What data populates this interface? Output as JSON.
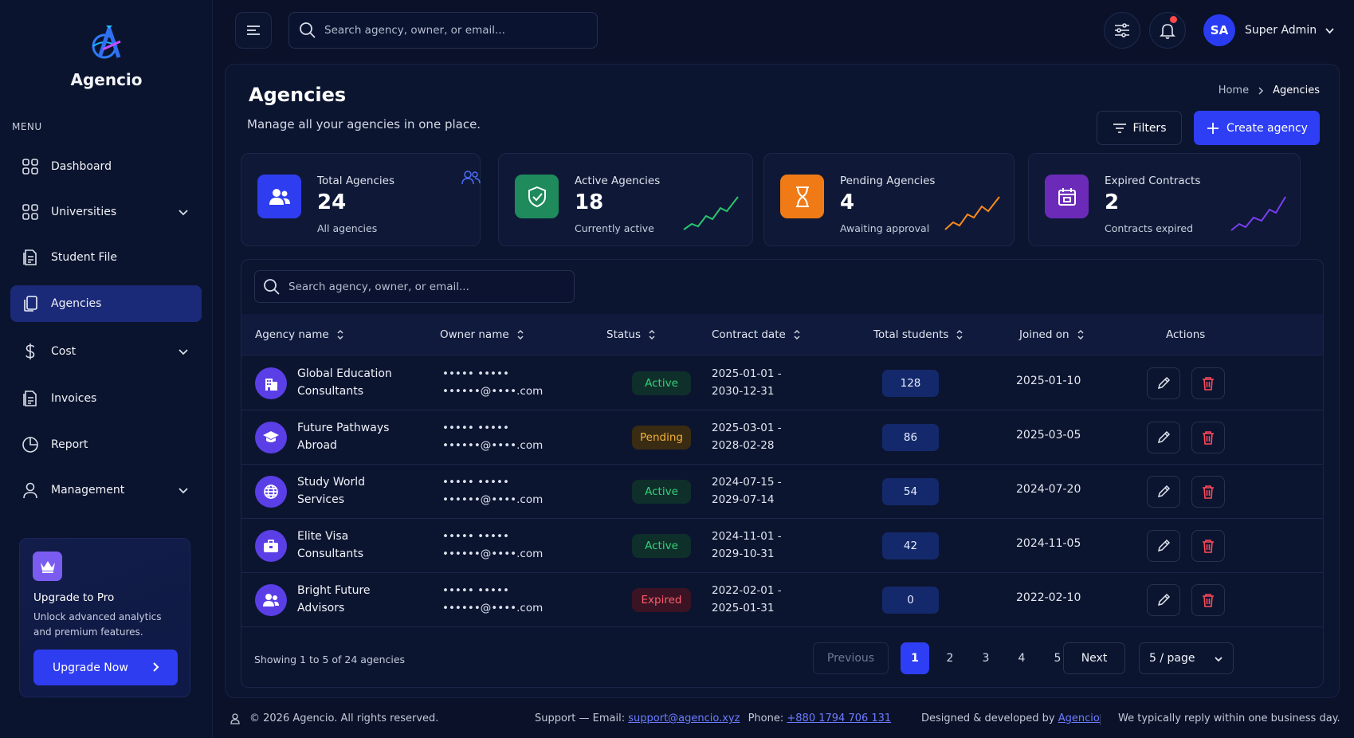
{
  "brand": {
    "name": "Agencio"
  },
  "sidebar": {
    "menu_label": "MENU",
    "items": [
      {
        "label": "Dashboard",
        "icon": "grid-icon",
        "has_chevron": false,
        "active": false
      },
      {
        "label": "Universities",
        "icon": "grid-icon",
        "has_chevron": true,
        "active": false
      },
      {
        "label": "Student File",
        "icon": "file-icon",
        "has_chevron": false,
        "active": false
      },
      {
        "label": "Agencies",
        "icon": "copy-icon",
        "has_chevron": false,
        "active": true
      },
      {
        "label": "Cost",
        "icon": "dollar-icon",
        "has_chevron": true,
        "active": false
      },
      {
        "label": "Invoices",
        "icon": "file-icon",
        "has_chevron": false,
        "active": false
      },
      {
        "label": "Report",
        "icon": "pie-chart-icon",
        "has_chevron": false,
        "active": false
      },
      {
        "label": "Management",
        "icon": "user-icon",
        "has_chevron": true,
        "active": false
      }
    ],
    "promo": {
      "title": "Upgrade to Pro",
      "description": "Unlock advanced analytics and premium features.",
      "button_label": "Upgrade Now"
    }
  },
  "topbar": {
    "search_placeholder": "Search agency, owner, or email...",
    "user_initials": "SA",
    "user_name": "Super Admin"
  },
  "page": {
    "title": "Agencies",
    "subtitle": "Manage all your agencies in one place.",
    "breadcrumb": {
      "home": "Home",
      "current": "Agencies"
    },
    "filters_label": "Filters",
    "create_label": "Create agency"
  },
  "stats": [
    {
      "label": "Total Agencies",
      "value": "24",
      "note": "All agencies",
      "color": "#2f3df0",
      "icon": "users-icon"
    },
    {
      "label": "Active Agencies",
      "value": "18",
      "note": "Currently active",
      "color": "#1f8a5b",
      "icon": "shield-check-icon"
    },
    {
      "label": "Pending Agencies",
      "value": "4",
      "note": "Awaiting approval",
      "color": "#f07b16",
      "icon": "hourglass-icon"
    },
    {
      "label": "Expired Contracts",
      "value": "2",
      "note": "Contracts expired",
      "color": "#6b2bb8",
      "icon": "calendar-icon"
    }
  ],
  "table": {
    "search_placeholder": "Search agency, owner, or email...",
    "columns": [
      "Agency name",
      "Owner name",
      "Status",
      "Contract date",
      "Total students",
      "Joined on",
      "Actions"
    ],
    "rows": [
      {
        "name_line1": "Global Education",
        "name_line2": "Consultants",
        "owner_line1": "••••• •••••",
        "owner_line2": "••••••@••••.com",
        "status": "Active",
        "contract_line1": "2025-01-01 -",
        "contract_line2": "2030-12-31",
        "students": "128",
        "joined": "2025-01-10",
        "icon": "building-icon"
      },
      {
        "name_line1": "Future Pathways",
        "name_line2": "Abroad",
        "owner_line1": "••••• •••••",
        "owner_line2": "••••••@••••.com",
        "status": "Pending",
        "contract_line1": "2025-03-01 -",
        "contract_line2": "2028-02-28",
        "students": "86",
        "joined": "2025-03-05",
        "icon": "graduation-cap-icon"
      },
      {
        "name_line1": "Study World",
        "name_line2": "Services",
        "owner_line1": "••••• •••••",
        "owner_line2": "••••••@••••.com",
        "status": "Active",
        "contract_line1": "2024-07-15 -",
        "contract_line2": "2029-07-14",
        "students": "54",
        "joined": "2024-07-20",
        "icon": "globe-icon"
      },
      {
        "name_line1": "Elite Visa",
        "name_line2": "Consultants",
        "owner_line1": "••••• •••••",
        "owner_line2": "••••••@••••.com",
        "status": "Active",
        "contract_line1": "2024-11-01 -",
        "contract_line2": "2029-10-31",
        "students": "42",
        "joined": "2024-11-05",
        "icon": "briefcase-icon"
      },
      {
        "name_line1": "Bright Future",
        "name_line2": "Advisors",
        "owner_line1": "••••• •••••",
        "owner_line2": "••••••@••••.com",
        "status": "Expired",
        "contract_line1": "2022-02-01 -",
        "contract_line2": "2025-01-31",
        "students": "0",
        "joined": "2022-02-10",
        "icon": "users-icon"
      }
    ],
    "showing": "Showing 1 to 5 of 24 agencies",
    "pagination": {
      "previous": "Previous",
      "pages": [
        "1",
        "2",
        "3",
        "4",
        "5"
      ],
      "current": "1",
      "next": "Next",
      "page_size": "5 / page"
    }
  },
  "footer": {
    "copyright": "© 2026 Agencio. All rights reserved.",
    "support_prefix": "Support — Email:",
    "support_email": "support@agencio.xyz",
    "phone_prefix": "Phone:",
    "phone": "+880 1794 706 131",
    "designed_prefix": "Designed & developed by",
    "designed_by": "Agencio",
    "reply_note": "We typically reply within one business day."
  },
  "colors": {
    "accent": "#2e3ef4",
    "active": "#33d17a",
    "pending": "#f4b03a",
    "expired": "#ff5d6c"
  }
}
